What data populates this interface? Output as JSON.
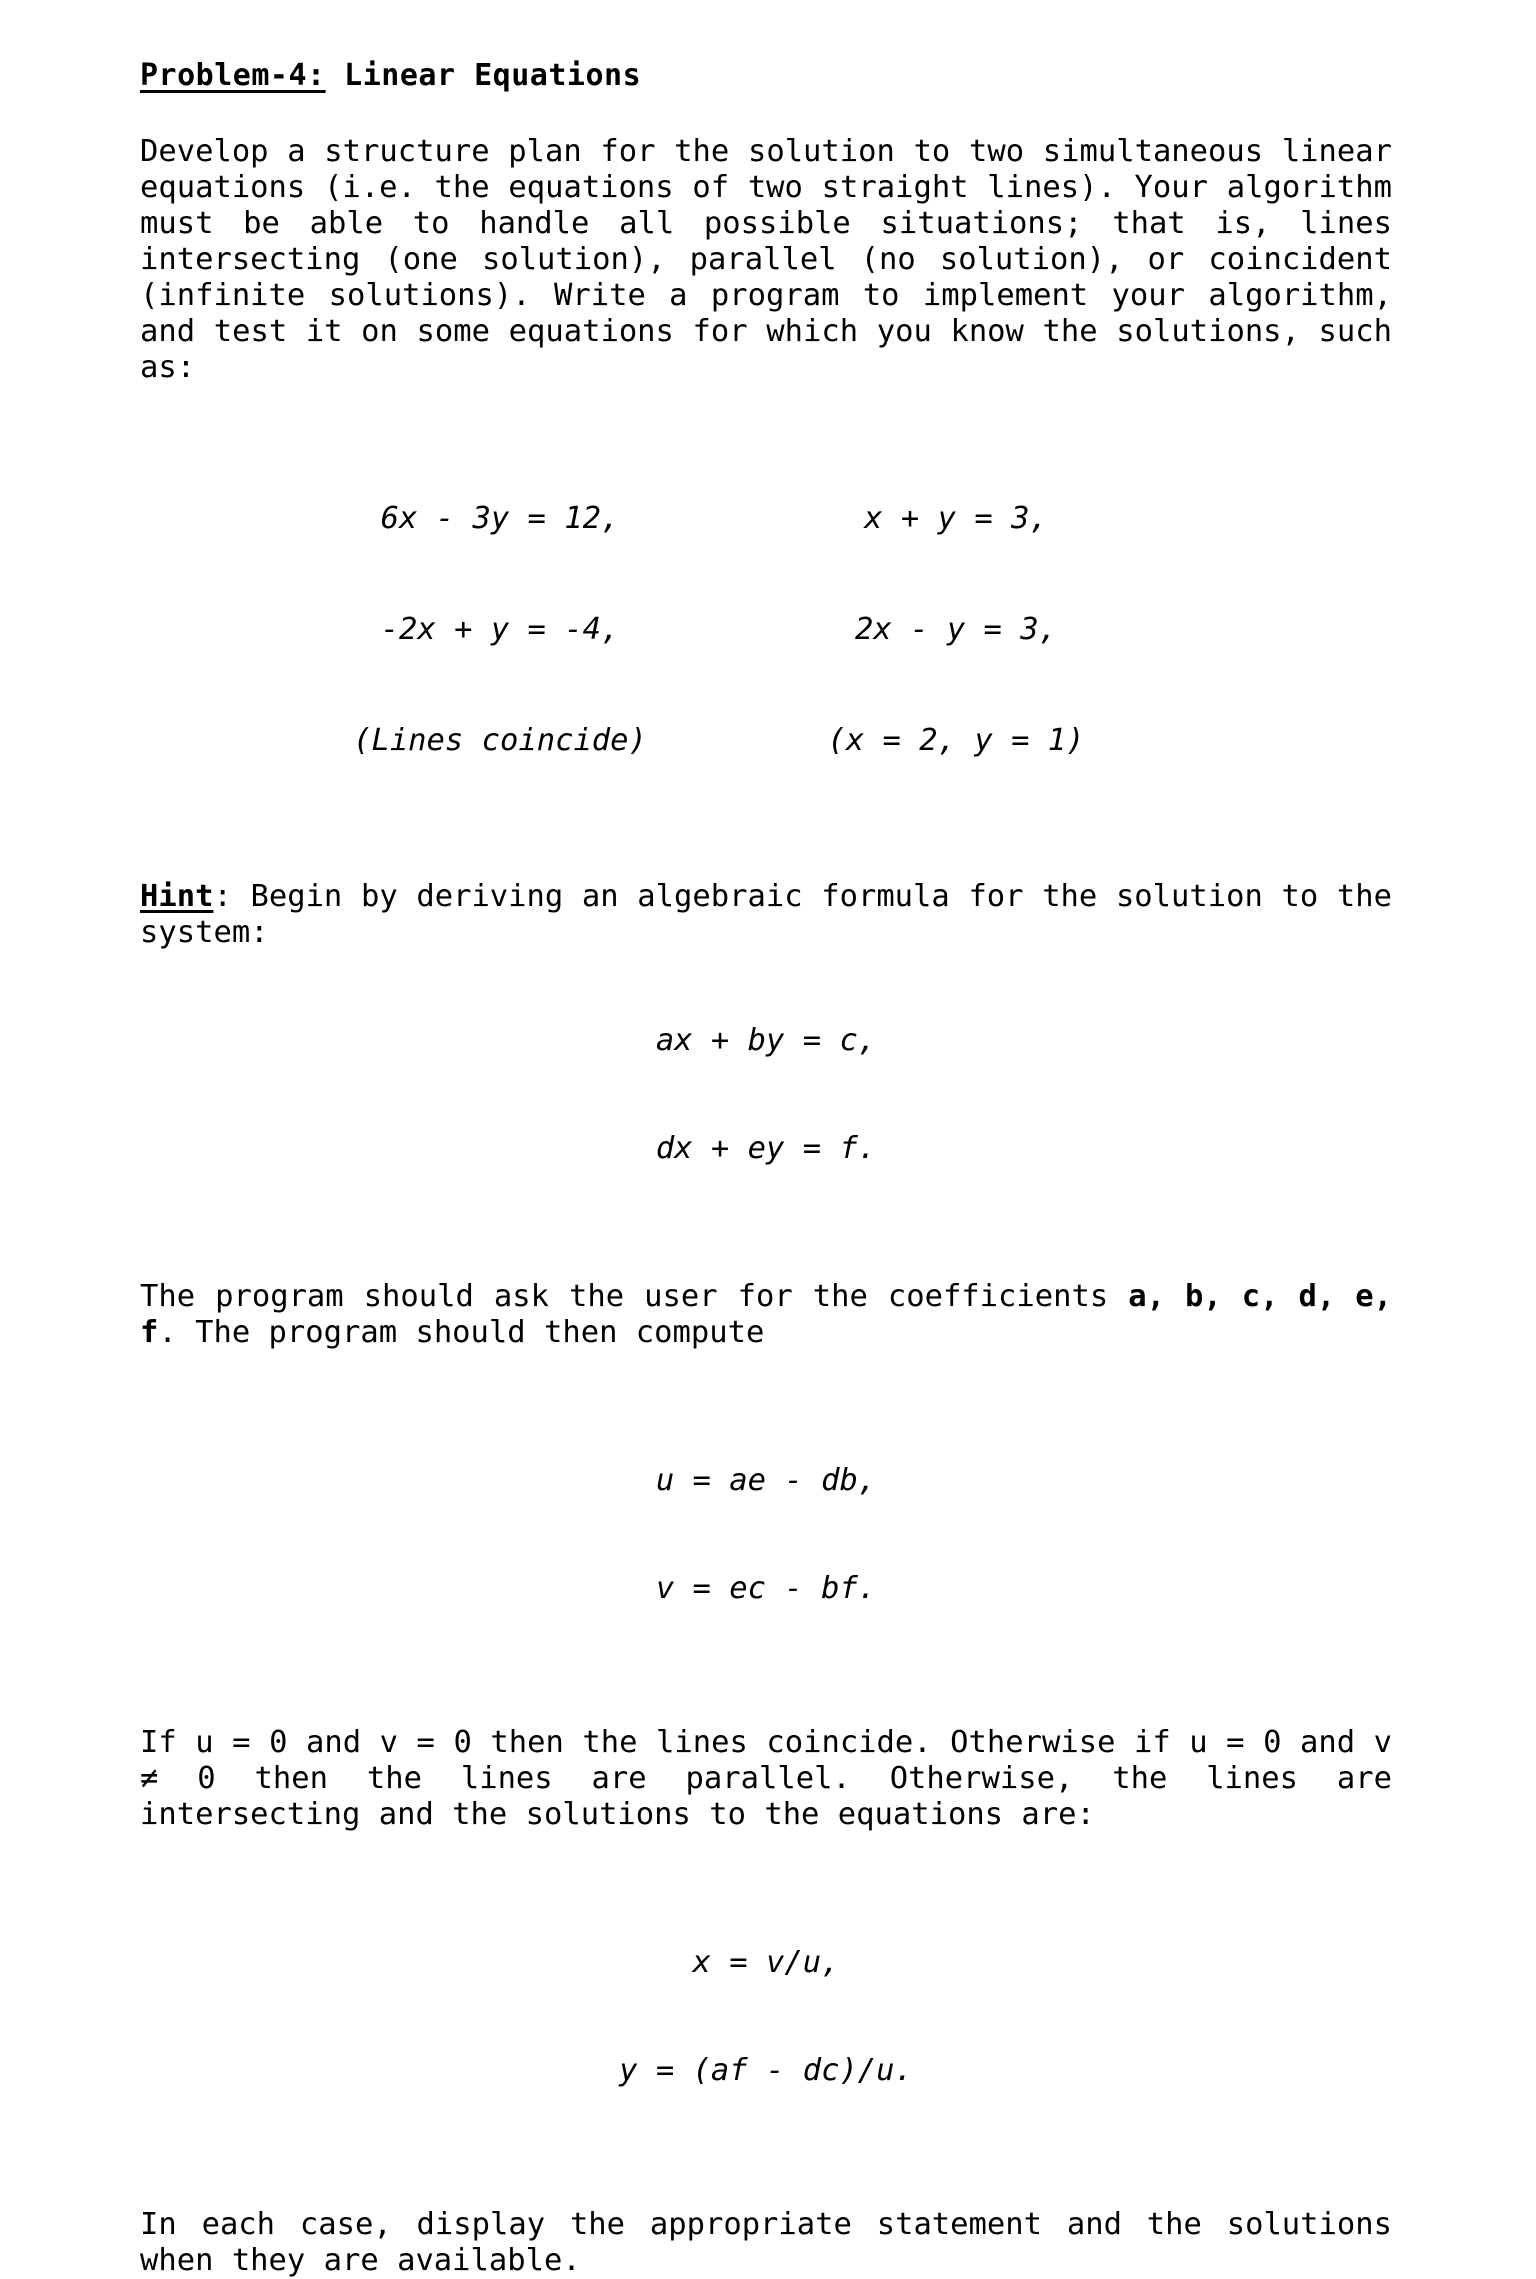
{
  "document": {
    "title": {
      "label_underlined": "Problem-4:",
      "label_rest": " Linear Equations"
    },
    "paragraphs": {
      "intro": "Develop a structure plan for the solution to two simultaneous linear equations (i.e. the equations of two straight lines). Your algorithm must be able to handle all possible situations; that is, lines intersecting (one solution), parallel (no solution), or coincident (infinite solutions). Write a program to implement your algorithm, and test it on some equations for which you know the solutions, such as:",
      "hint_label": "Hint",
      "hint_colon": ": ",
      "hint_text": "Begin by deriving an algebraic formula for the solution to the system:",
      "compute_part1": "The program should ask the user for the coefficients ",
      "compute_coeffs_1": "a, b, c, d, e, f",
      "compute_part2": ". The program should then compute",
      "conditions": "If u = 0 and v = 0 then the lines coincide. Otherwise if u = 0 and v ≠ 0 then the lines are parallel. Otherwise, the lines are intersecting and the solutions to the equations are:",
      "closing": "In each case, display the appropriate statement and the solutions when they are available."
    },
    "example_equations": {
      "left_column": [
        "6x - 3y = 12,",
        "-2x + y = -4,",
        "(Lines coincide)"
      ],
      "right_column": [
        "x + y = 3,",
        "2x - y = 3,",
        "(x = 2, y = 1)"
      ]
    },
    "system_equations": [
      "ax + by = c,",
      "dx + ey = f."
    ],
    "compute_equations": [
      "u = ae - db,",
      "v = ec - bf."
    ],
    "solution_equations": [
      "x = v/u,",
      "y = (af - dc)/u."
    ]
  }
}
